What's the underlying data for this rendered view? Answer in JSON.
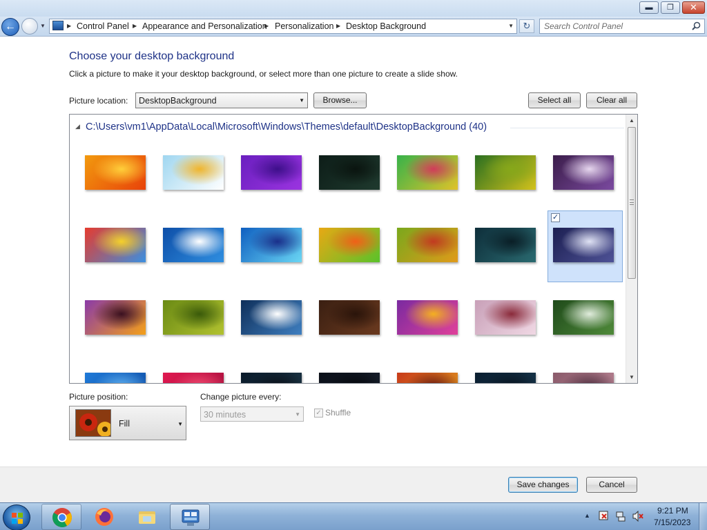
{
  "window": {
    "minimize_icon": "minimize-icon",
    "maximize_icon": "restore-icon",
    "close_icon": "close-icon"
  },
  "navigation": {
    "back_icon": "back-arrow-icon",
    "forward_icon": "forward-arrow-icon",
    "breadcrumb": [
      "Control Panel",
      "Appearance and Personalization",
      "Personalization",
      "Desktop Background"
    ],
    "search_placeholder": "Search Control Panel"
  },
  "page": {
    "title": "Choose your desktop background",
    "subtitle": "Click a picture to make it your desktop background, or select more than one picture to create a slide show."
  },
  "location": {
    "label": "Picture location:",
    "value": "DesktopBackground",
    "browse_label": "Browse...",
    "select_all_label": "Select all",
    "clear_all_label": "Clear all"
  },
  "gallery": {
    "group_header": "C:\\Users\\vm1\\AppData\\Local\\Microsoft\\Windows\\Themes\\default\\DesktopBackground (40)",
    "selected_index": 13,
    "thumbnails": [
      {
        "colors": [
          "#f29a0e",
          "#e8420a",
          "#ffcf3a"
        ]
      },
      {
        "colors": [
          "#9fd6f0",
          "#ffffff",
          "#f0b52c"
        ]
      },
      {
        "colors": [
          "#6a1fbf",
          "#9b34e0",
          "#3d0f8a"
        ]
      },
      {
        "colors": [
          "#0d1d18",
          "#1f3a2e",
          "#0a140f"
        ]
      },
      {
        "colors": [
          "#37b24a",
          "#e0c22a",
          "#d23b5a"
        ]
      },
      {
        "colors": [
          "#2a6f20",
          "#d3c21c",
          "#87a81a"
        ]
      },
      {
        "colors": [
          "#3b1d4a",
          "#7b4aa0",
          "#e6d6ee"
        ]
      },
      {
        "colors": [
          "#e63b2e",
          "#3b8fe0",
          "#f5d12a"
        ]
      },
      {
        "colors": [
          "#0e4fa8",
          "#2f8ee0",
          "#ffffff"
        ]
      },
      {
        "colors": [
          "#0f5fc0",
          "#6ad6f4",
          "#1a2f8a"
        ]
      },
      {
        "colors": [
          "#e8a814",
          "#59c22a",
          "#f06018"
        ]
      },
      {
        "colors": [
          "#7aa81c",
          "#e09a1a",
          "#c23a20"
        ]
      },
      {
        "colors": [
          "#0e2e3a",
          "#2a6a70",
          "#0a1e26"
        ]
      },
      {
        "colors": [
          "#1c1f52",
          "#4e5296",
          "#dfe2f4"
        ]
      },
      {
        "colors": [
          "#8a3aa8",
          "#f4a018",
          "#3a1020"
        ]
      },
      {
        "colors": [
          "#6a8a14",
          "#b2c230",
          "#3a5a0a"
        ]
      },
      {
        "colors": [
          "#0f2f5a",
          "#3f7fc0",
          "#ffffff"
        ]
      },
      {
        "colors": [
          "#3a1f12",
          "#6b3a1f",
          "#2a140a"
        ]
      },
      {
        "colors": [
          "#7a2aa0",
          "#e0409a",
          "#f4b020"
        ]
      },
      {
        "colors": [
          "#c8a0b8",
          "#f0d8e4",
          "#8a2a3a"
        ]
      },
      {
        "colors": [
          "#1f4a1a",
          "#4f8a3a",
          "#e0ecdc"
        ]
      },
      {
        "colors": [
          "#1f7ad8",
          "#0f4aa0",
          "#5fb0f0"
        ]
      },
      {
        "colors": [
          "#e01850",
          "#a0103a",
          "#f04a70"
        ]
      },
      {
        "colors": [
          "#0a1a2a",
          "#1f3a4a",
          "#0a1018"
        ]
      },
      {
        "colors": [
          "#0a0f18",
          "#1a2230",
          "#05080c"
        ]
      },
      {
        "colors": [
          "#c83a1a",
          "#e0a020",
          "#6a1a10"
        ]
      },
      {
        "colors": [
          "#0a1e30",
          "#1a3a50",
          "#081420"
        ]
      },
      {
        "colors": [
          "#8a5a6a",
          "#c08a9a",
          "#503040"
        ]
      }
    ]
  },
  "position": {
    "label": "Picture position:",
    "value": "Fill"
  },
  "slideshow": {
    "label": "Change picture every:",
    "interval_value": "30 minutes",
    "shuffle_label": "Shuffle"
  },
  "footer": {
    "save_label": "Save changes",
    "cancel_label": "Cancel"
  },
  "taskbar": {
    "items": [
      {
        "name": "chrome-icon"
      },
      {
        "name": "firefox-icon"
      },
      {
        "name": "file-explorer-icon"
      },
      {
        "name": "control-panel-icon"
      }
    ],
    "clock_time": "9:21 PM",
    "clock_date": "7/15/2023"
  }
}
